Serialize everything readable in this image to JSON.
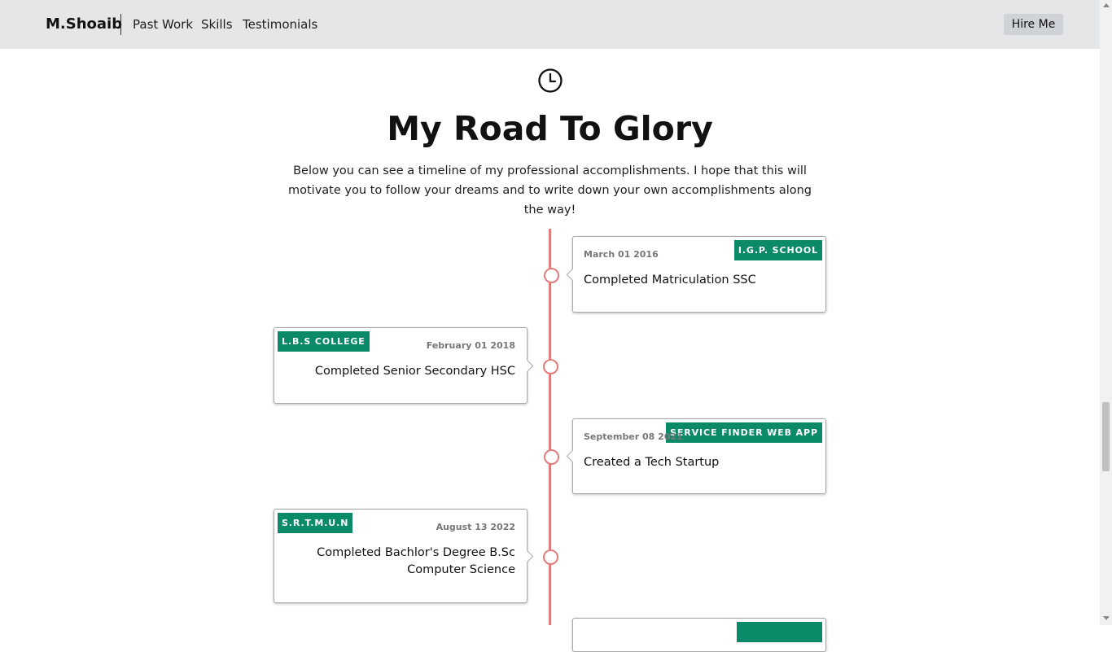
{
  "navbar": {
    "brand": "M.Shoaib",
    "links": [
      "Past Work",
      "Skills",
      "Testimonials"
    ],
    "cta": "Hire Me"
  },
  "hero": {
    "icon": "clock-icon",
    "title": "My Road To Glory",
    "intro": "Below you can see a timeline of my professional accomplishments. I hope that this will motivate you to follow your dreams and to write down your own accomplishments along the way!"
  },
  "timeline": {
    "line_color": "#e27c7c",
    "badge_color": "#0b8a6a",
    "items": [
      {
        "side": "right",
        "date": "March 01 2016",
        "tag": "I.G.P. SCHOOL",
        "text": "Completed Matriculation SSC"
      },
      {
        "side": "left",
        "date": "February 01 2018",
        "tag": "L.B.S COLLEGE",
        "text": "Completed Senior Secondary HSC"
      },
      {
        "side": "right",
        "date": "September 08 2021",
        "tag": "SERVICE FINDER WEB APP",
        "text": "Created a Tech Startup"
      },
      {
        "side": "left",
        "date": "August 13 2022",
        "tag": "S.R.T.M.U.N",
        "text": "Completed Bachlor's Degree B.Sc Computer Science"
      }
    ]
  }
}
